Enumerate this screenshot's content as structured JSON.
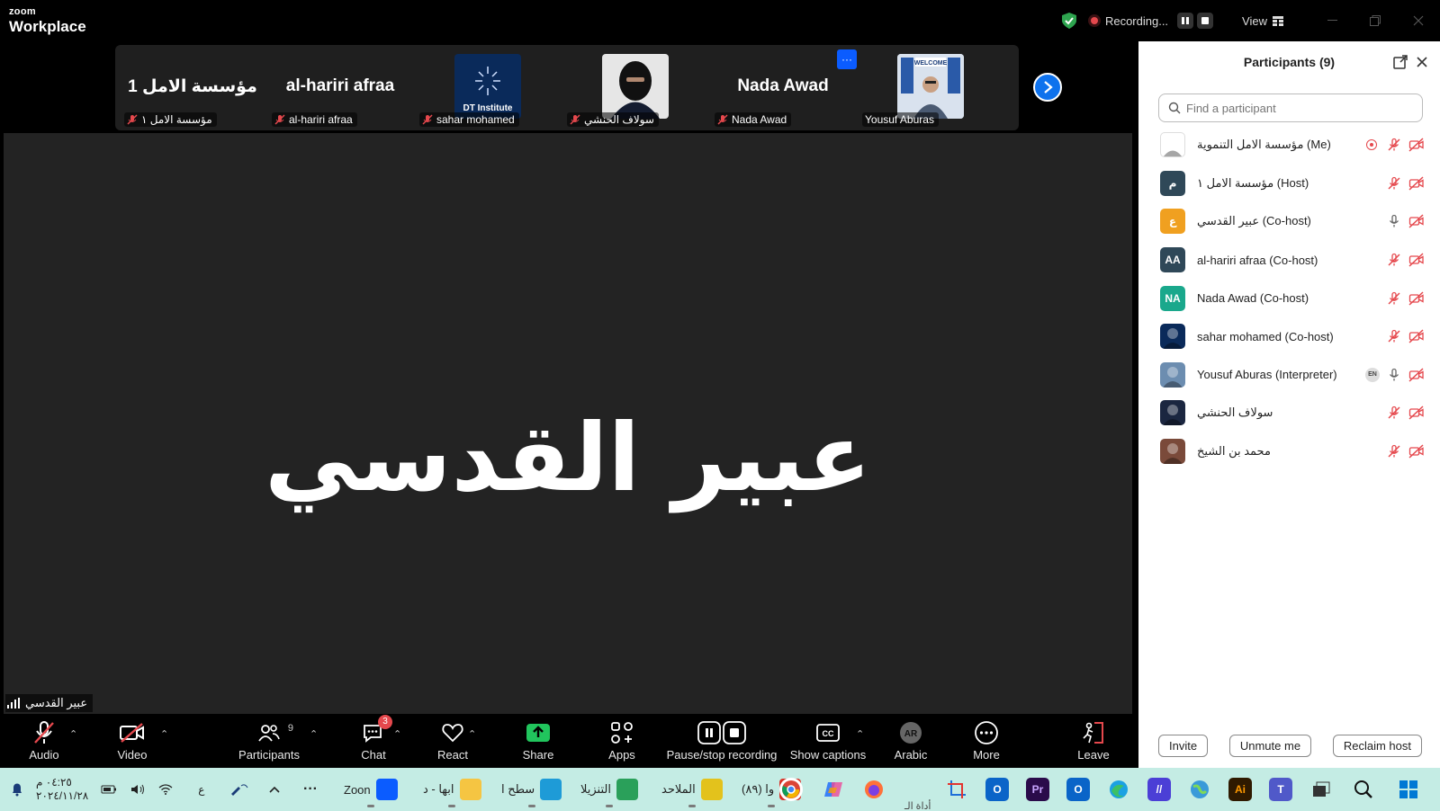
{
  "app": {
    "brand_small": "zoom",
    "brand_big": "Workplace"
  },
  "titlebar": {
    "recording_label": "Recording...",
    "view_label": "View"
  },
  "filmstrip": {
    "tiles": [
      {
        "display": "مؤسسة الامل 1",
        "label": "مؤسسة الامل ١"
      },
      {
        "display": "al-hariri afraa",
        "label": "al-hariri afraa"
      },
      {
        "display": "",
        "label": "sahar mohamed",
        "thumb_text": "DT Institute"
      },
      {
        "display": "",
        "label": "سولاف الحنشي"
      },
      {
        "display": "Nada Awad",
        "label": "Nada Awad"
      },
      {
        "display": "",
        "label": "Yousuf Aburas",
        "thumb_text": "WELCOME"
      }
    ],
    "more_label": "···"
  },
  "main": {
    "speaker_big": "عبير القدسي",
    "speaker_tag": "عبير القدسي"
  },
  "toolbar": {
    "audio": "Audio",
    "video": "Video",
    "participants": "Participants",
    "participants_count": "9",
    "chat": "Chat",
    "chat_badge": "3",
    "react": "React",
    "share": "Share",
    "apps": "Apps",
    "recording": "Pause/stop recording",
    "captions": "Show captions",
    "captions_icon": "CC",
    "language": "Arabic",
    "language_avatar": "AR",
    "more": "More",
    "leave": "Leave"
  },
  "panel": {
    "title": "Participants (9)",
    "search_placeholder": "Find a participant",
    "participants": [
      {
        "name": "مؤسسة الامل التنموية (Me)",
        "avatar": "",
        "avatar_color": "#ffffff",
        "mic": "muted",
        "extra": "share-dot"
      },
      {
        "name": "مؤسسة الامل ١ (Host)",
        "avatar": "م",
        "avatar_color": "#2f4858",
        "mic": "muted"
      },
      {
        "name": "عبير القدسي (Co-host)",
        "avatar": "ع",
        "avatar_color": "#f0a020",
        "mic": "on"
      },
      {
        "name": "al-hariri afraa (Co-host)",
        "avatar": "AA",
        "avatar_color": "#2f4858",
        "mic": "muted"
      },
      {
        "name": "Nada Awad (Co-host)",
        "avatar": "NA",
        "avatar_color": "#1aa88c",
        "mic": "muted"
      },
      {
        "name": "sahar mohamed (Co-host)",
        "avatar": "",
        "avatar_color": "#0a2a5a",
        "mic": "muted"
      },
      {
        "name": "Yousuf Aburas (Interpreter)",
        "avatar": "",
        "avatar_color": "#6c8db0",
        "mic": "on",
        "extra": "EN"
      },
      {
        "name": "سولاف الحنشي",
        "avatar": "",
        "avatar_color": "#1b2640",
        "mic": "muted"
      },
      {
        "name": "محمد بن الشيخ",
        "avatar": "",
        "avatar_color": "#7a4a3a",
        "mic": "muted"
      }
    ],
    "invite": "Invite",
    "unmute_me": "Unmute me",
    "reclaim_host": "Reclaim host"
  },
  "taskbar": {
    "time": "٠٤:٢٥ م",
    "date": "٢٠٢٤/١١/٢٨",
    "lang": "ع",
    "apps": [
      {
        "label": "Zoon",
        "color": "#0b5cff"
      },
      {
        "label": "ابها - د",
        "color": "#f5c542"
      },
      {
        "label": "سطح ا",
        "color": "#1e9bd7"
      },
      {
        "label": "التنزيلا",
        "color": "#2aa05a"
      },
      {
        "label": "الملاحد",
        "color": "#e3c21c"
      },
      {
        "label": "(٨٩) وا",
        "color": "#d93025"
      }
    ],
    "app_dots_label": "···",
    "fragment": "أداة الـ"
  }
}
